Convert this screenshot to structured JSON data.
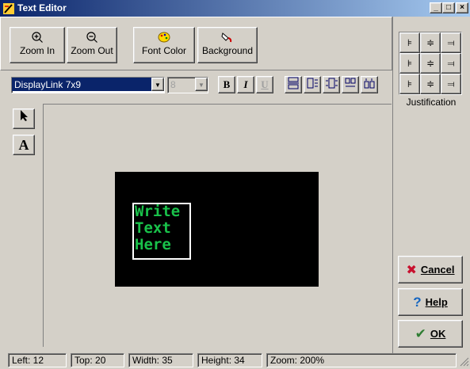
{
  "window": {
    "title": "Text Editor",
    "controls": [
      "_",
      "□",
      "×"
    ]
  },
  "toolbar": {
    "zoom_in": "Zoom In",
    "zoom_out": "Zoom Out",
    "font_color": "Font Color",
    "background": "Background"
  },
  "format": {
    "font_name": "DisplayLink 7x9",
    "font_size": "8",
    "bold": "B",
    "italic": "I",
    "underline": "U"
  },
  "tools": [
    "select-arrow",
    "text-tool"
  ],
  "canvas": {
    "lines": [
      "Write",
      "Text",
      "Here"
    ],
    "led_color": "#19c24a",
    "background_color": "#000000"
  },
  "justification": {
    "label": "Justification"
  },
  "buttons": {
    "cancel": "Cancel",
    "help": "Help",
    "ok": "OK"
  },
  "status": {
    "left": "Left: 12",
    "top": "Top: 20",
    "width": "Width: 35",
    "height": "Height: 34",
    "zoom": "Zoom: 200%"
  }
}
